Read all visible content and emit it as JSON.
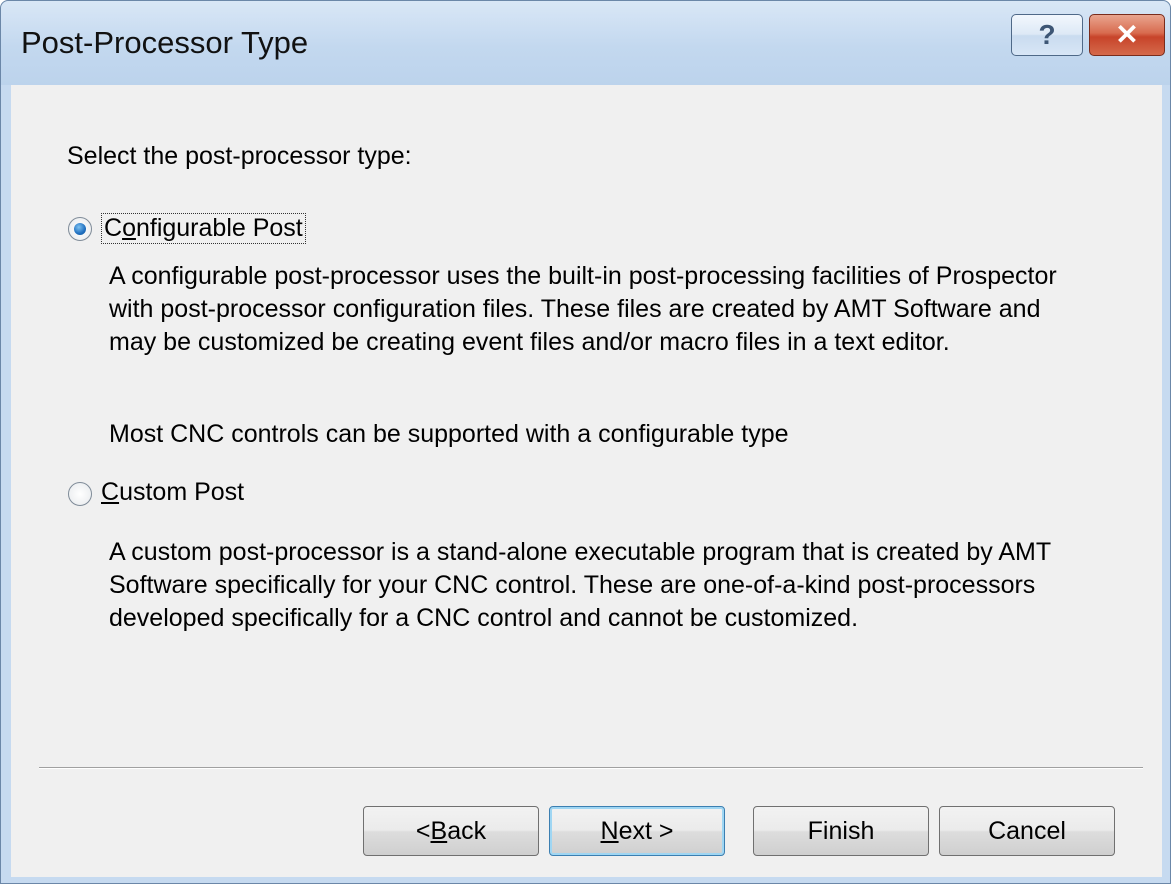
{
  "window": {
    "title": "Post-Processor Type",
    "help_glyph": "?",
    "close_glyph": "✕"
  },
  "prompt": "Select the post-processor type:",
  "options": [
    {
      "label_first": "C",
      "label_mnemonic": "o",
      "label_rest": "nfigurable Post",
      "selected": true,
      "description": [
        "A configurable post-processor uses the built-in post-processing facilities of Prospector",
        "with post-processor configuration files.  These files are created by AMT Software and",
        "may be customized be creating event files and/or macro files in a text editor."
      ],
      "note": "Most CNC controls can be supported with a configurable type"
    },
    {
      "label_first": "",
      "label_mnemonic": "C",
      "label_rest": "ustom Post",
      "selected": false,
      "description": [
        "A custom post-processor is a stand-alone executable program that is created by AMT",
        "Software specifically for your CNC control.  These are one-of-a-kind post-processors",
        "developed specifically for a CNC control and cannot be customized."
      ]
    }
  ],
  "buttons": {
    "back_prefix": "< ",
    "back_mnemonic": "B",
    "back_rest": "ack",
    "next_mnemonic": "N",
    "next_rest": "ext >",
    "finish": "Finish",
    "cancel": "Cancel"
  }
}
